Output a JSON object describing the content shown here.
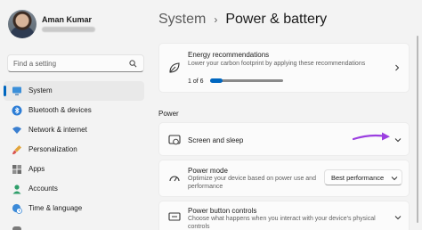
{
  "user": {
    "name": "Aman Kumar"
  },
  "search": {
    "placeholder": "Find a setting"
  },
  "sidebar": {
    "items": [
      {
        "label": "System",
        "icon": "monitor-icon",
        "active": true
      },
      {
        "label": "Bluetooth & devices",
        "icon": "bluetooth-icon"
      },
      {
        "label": "Network & internet",
        "icon": "wifi-icon"
      },
      {
        "label": "Personalization",
        "icon": "paintbrush-icon"
      },
      {
        "label": "Apps",
        "icon": "apps-icon"
      },
      {
        "label": "Accounts",
        "icon": "person-icon"
      },
      {
        "label": "Time & language",
        "icon": "globe-clock-icon"
      }
    ]
  },
  "breadcrumb": {
    "root": "System",
    "separator": "›",
    "current": "Power & battery"
  },
  "energy": {
    "title": "Energy recommendations",
    "subtitle": "Lower your carbon footprint by applying these recommendations",
    "progress_text": "1 of 6",
    "progress_fraction": 0.167
  },
  "section": {
    "label": "Power"
  },
  "screen_sleep": {
    "title": "Screen and sleep"
  },
  "power_mode": {
    "title": "Power mode",
    "subtitle": "Optimize your device based on power use and performance",
    "selected": "Best performance"
  },
  "power_button": {
    "title": "Power button controls",
    "subtitle": "Choose what happens when you interact with your device's physical controls"
  },
  "colors": {
    "accent": "#0067c0",
    "annotation_arrow": "#9b3fe0",
    "page_background": "#f3f3f3",
    "card_background": "#fbfbfb"
  }
}
